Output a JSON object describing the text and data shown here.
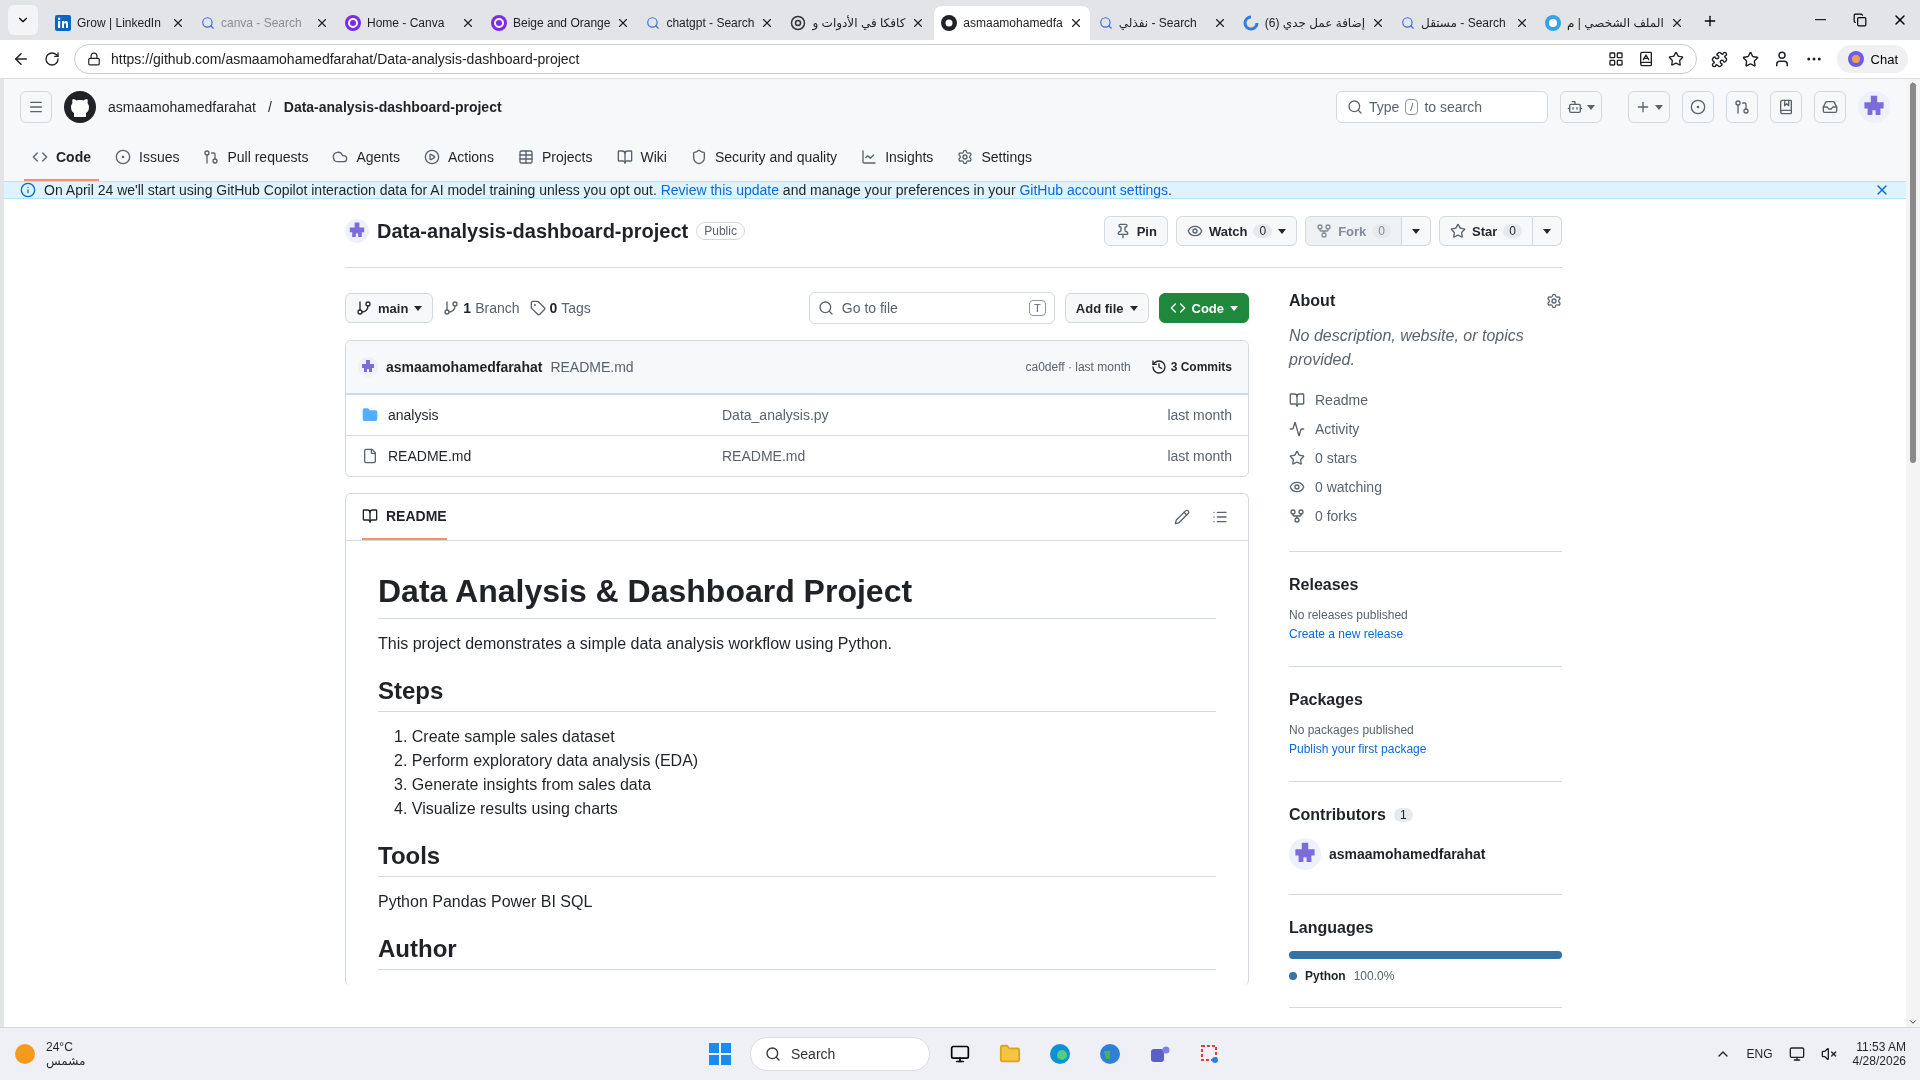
{
  "browser": {
    "tabs": [
      {
        "kind": "linkedin",
        "title": "Grow | LinkedIn",
        "selected": false,
        "sleeping": false
      },
      {
        "kind": "search",
        "title": "canva - Search",
        "selected": false,
        "sleeping": true
      },
      {
        "kind": "canva",
        "title": "Home - Canva",
        "selected": false,
        "sleeping": false
      },
      {
        "kind": "canva",
        "title": "Beige and Orange",
        "selected": false,
        "sleeping": false
      },
      {
        "kind": "search",
        "title": "chatgpt - Search",
        "selected": false,
        "sleeping": false
      },
      {
        "kind": "chatgpt",
        "title": "كافكا في الأدوات و",
        "selected": false,
        "sleeping": false
      },
      {
        "kind": "github",
        "title": "asmaamohamedfa",
        "selected": true,
        "sleeping": false
      },
      {
        "kind": "search",
        "title": "نفذلي - Search",
        "selected": false,
        "sleeping": false
      },
      {
        "kind": "spinner",
        "title": "(6) إضافة عمل جدي",
        "selected": false,
        "sleeping": false
      },
      {
        "kind": "search",
        "title": "مستقل - Search",
        "selected": false,
        "sleeping": false
      },
      {
        "kind": "ring",
        "title": "الملف الشخصي | م",
        "selected": false,
        "sleeping": false
      }
    ],
    "url": "https://github.com/asmaamohamedfarahat/Data-analysis-dashboard-project",
    "chat": "Chat"
  },
  "header": {
    "owner": "asmaamohamedfarahat",
    "separator": "/",
    "repo": "Data-analysis-dashboard-project",
    "search": {
      "before": "Type",
      "key": "/",
      "after": "to search"
    }
  },
  "nav": [
    {
      "kind": "code",
      "label": "Code",
      "selected": true
    },
    {
      "kind": "issue",
      "label": "Issues",
      "selected": false
    },
    {
      "kind": "pr",
      "label": "Pull requests",
      "selected": false
    },
    {
      "kind": "agents",
      "label": "Agents",
      "selected": false
    },
    {
      "kind": "play",
      "label": "Actions",
      "selected": false
    },
    {
      "kind": "table",
      "label": "Projects",
      "selected": false
    },
    {
      "kind": "book",
      "label": "Wiki",
      "selected": false
    },
    {
      "kind": "shield",
      "label": "Security and quality",
      "selected": false
    },
    {
      "kind": "graph",
      "label": "Insights",
      "selected": false
    },
    {
      "kind": "gear",
      "label": "Settings",
      "selected": false
    }
  ],
  "banner": {
    "parts": [
      {
        "kind": "text",
        "text": "On April 24 we'll start using GitHub Copilot interaction data for AI model training unless you opt out. "
      },
      {
        "kind": "link",
        "text": "Review this update"
      },
      {
        "kind": "text",
        "text": " and manage your preferences in your "
      },
      {
        "kind": "link",
        "text": "GitHub account settings"
      },
      {
        "kind": "text",
        "text": "."
      }
    ]
  },
  "repo": {
    "name": "Data-analysis-dashboard-project",
    "visibility": "Public",
    "actions": [
      {
        "kind": "pin",
        "label": "Pin",
        "disabled": false
      },
      {
        "kind": "watch",
        "label": "Watch",
        "count": "0",
        "disabled": false
      },
      {
        "kind": "fork",
        "label": "Fork",
        "count": "0",
        "disabled": true
      },
      {
        "kind": "star",
        "label": "Star",
        "count": "0",
        "disabled": false
      }
    ]
  },
  "toolbar": {
    "branch": "main",
    "branches": {
      "count": "1",
      "label": "Branch"
    },
    "tags": {
      "count": "0",
      "label": "Tags"
    },
    "file_search": {
      "placeholder": "Go to file",
      "key": "T"
    },
    "add_file": "Add file",
    "code": "Code"
  },
  "commit": {
    "author": "asmaamohamedfarahat",
    "message": "README.md",
    "hash_time": "ca0deff · last month",
    "commits": "3 Commits"
  },
  "files": [
    {
      "kind": "folder",
      "name": "analysis",
      "message": "Data_analysis.py",
      "time": "last month"
    },
    {
      "kind": "file",
      "name": "README.md",
      "message": "README.md",
      "time": "last month"
    }
  ],
  "readme": {
    "tabs": [
      {
        "label": "README",
        "selected": true
      }
    ],
    "blocks": [
      {
        "kind": "h1",
        "text": "Data Analysis & Dashboard Project"
      },
      {
        "kind": "p",
        "text": "This project demonstrates a simple data analysis workflow using Python."
      },
      {
        "kind": "h2",
        "text": "Steps"
      },
      {
        "kind": "ol",
        "items": [
          {
            "number": "1.",
            "text": "Create sample sales dataset"
          },
          {
            "number": "2.",
            "text": "Perform exploratory data analysis (EDA)"
          },
          {
            "number": "3.",
            "text": "Generate insights from sales data"
          },
          {
            "number": "4.",
            "text": "Visualize results using charts"
          }
        ]
      },
      {
        "kind": "h2",
        "text": "Tools"
      },
      {
        "kind": "p",
        "text": "Python Pandas Power BI SQL"
      },
      {
        "kind": "h2",
        "text": "Author"
      }
    ]
  },
  "sidebar": {
    "about": {
      "title": "About",
      "description": "No description, website, or topics provided.",
      "links": [
        {
          "kind": "book",
          "label": "Readme"
        },
        {
          "kind": "pulse",
          "label": "Activity"
        },
        {
          "kind": "star",
          "label": "0 stars"
        },
        {
          "kind": "eye",
          "label": "0 watching"
        },
        {
          "kind": "fork",
          "label": "0 forks"
        }
      ]
    },
    "releases": {
      "title": "Releases",
      "note": "No releases published",
      "link": "Create a new release"
    },
    "packages": {
      "title": "Packages",
      "note": "No packages published",
      "link": "Publish your first package"
    },
    "contributors": {
      "title": "Contributors",
      "count": "1",
      "people": [
        {
          "name": "asmaamohamedfarahat"
        }
      ]
    },
    "languages": {
      "title": "Languages",
      "items": [
        {
          "name": "Python",
          "share": "100.0%",
          "level": 1,
          "color": "#3572a5"
        }
      ]
    }
  },
  "taskbar": {
    "temperature": "24°C",
    "weather": "مشمس",
    "search": "Search",
    "language": "ENG",
    "time": "11:53 AM",
    "date": "4/28/2026"
  }
}
